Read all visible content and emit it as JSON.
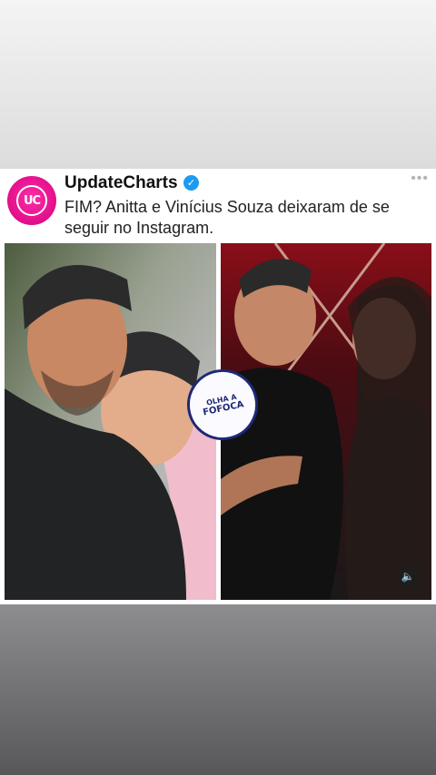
{
  "post": {
    "account_name": "UpdateCharts",
    "avatar_text": "UC",
    "verified_icon": "check-badge-icon",
    "more_label": "•••",
    "text": "FIM? Anitta e Vinícius Souza deixaram de se seguir no Instagram."
  },
  "sticker": {
    "line1": "OLHA A",
    "line2": "FOFOCA"
  },
  "controls": {
    "sound_icon": "speaker-icon",
    "sound_glyph": "🔈"
  }
}
